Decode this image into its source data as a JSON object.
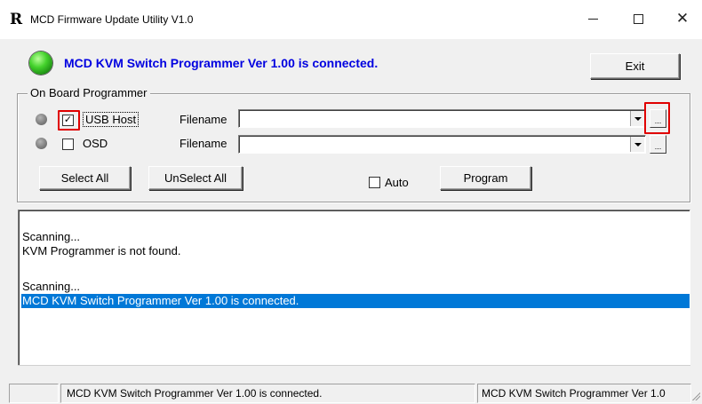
{
  "window": {
    "app_icon": "R",
    "title": "MCD Firmware Update Utility V1.0",
    "minimize_icon": "minimize-icon",
    "maximize_icon": "maximize-icon",
    "close_symbol": "✕"
  },
  "header": {
    "status_led_color": "#44d22c",
    "connection_text": "MCD KVM Switch Programmer Ver 1.00 is connected.",
    "exit_label": "Exit"
  },
  "programmer": {
    "group_label": "On Board Programmer",
    "rows": [
      {
        "label": "USB Host",
        "checked": true,
        "check_mark": "✓",
        "filename_label": "Filename",
        "filename_value": "",
        "browse_label": "..."
      },
      {
        "label": "OSD",
        "checked": false,
        "check_mark": "",
        "filename_label": "Filename",
        "filename_value": "",
        "browse_label": "..."
      }
    ],
    "select_all_label": "Select All",
    "unselect_all_label": "UnSelect All",
    "auto_label": "Auto",
    "auto_checked": false,
    "program_label": "Program"
  },
  "log": {
    "lines": [
      "Scanning...",
      "KVM Programmer is not found.",
      "",
      "Scanning...",
      "MCD KVM Switch Programmer Ver 1.00 is connected."
    ],
    "selected_index": 4
  },
  "statusbar": {
    "panes": [
      "",
      "MCD KVM Switch Programmer Ver 1.00 is connected.",
      "MCD KVM Switch Programmer Ver 1.0"
    ]
  },
  "colors": {
    "connection_text": "#0000e0",
    "selection": "#0078d7",
    "annotation": "#e00000"
  }
}
